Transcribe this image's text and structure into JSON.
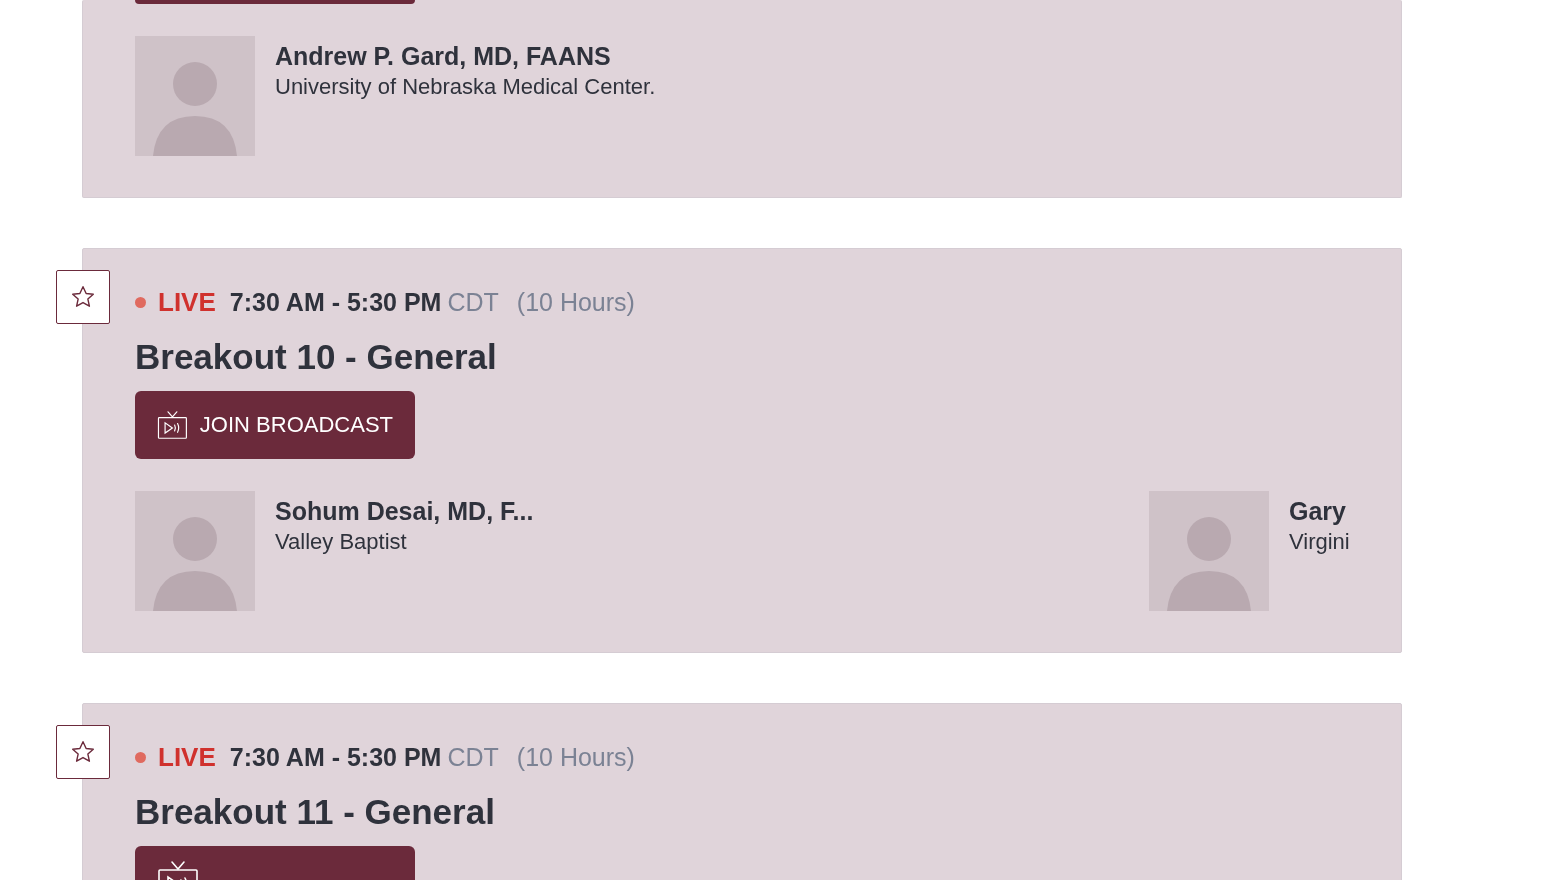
{
  "sessions": [
    {
      "kind": "cut",
      "speakers": [
        {
          "name": "Andrew P. Gard, MD, FAANS",
          "affiliation": "University of Nebraska Medical Center."
        }
      ]
    },
    {
      "kind": "full",
      "starred": false,
      "status": "LIVE",
      "time": "7:30 AM - 5:30 PM",
      "timezone": "CDT",
      "duration": "(10 Hours)",
      "title": "Breakout 10 - General",
      "button": "JOIN BROADCAST",
      "speakers": [
        {
          "name": "Sohum Desai, MD, F...",
          "affiliation": "Valley Baptist"
        },
        {
          "name": "Gary",
          "affiliation": "Virgini"
        }
      ]
    },
    {
      "kind": "full",
      "starred": false,
      "status": "LIVE",
      "time": "7:30 AM - 5:30 PM",
      "timezone": "CDT",
      "duration": "(10 Hours)",
      "title": "Breakout 11 - General"
    }
  ]
}
